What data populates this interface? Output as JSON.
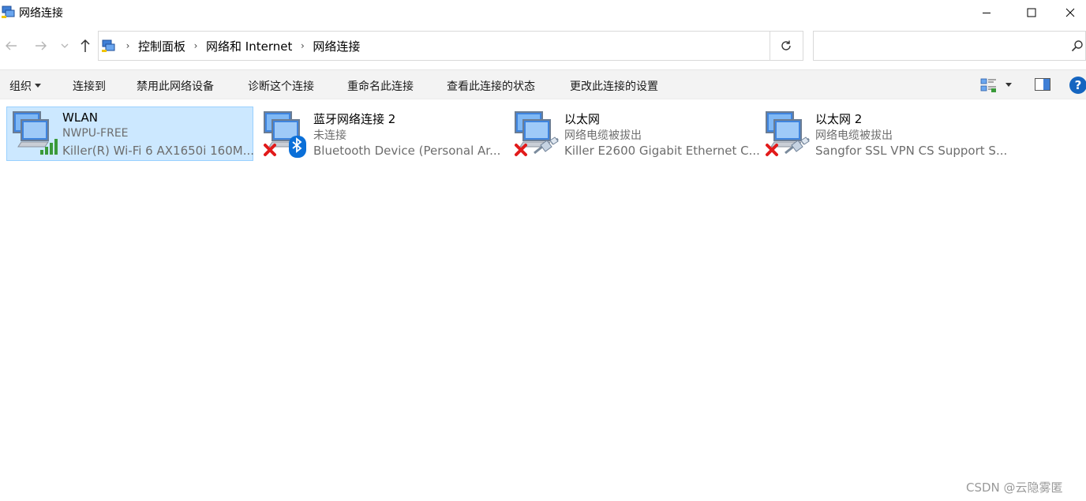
{
  "window": {
    "title": "网络连接"
  },
  "address": {
    "crumbs": [
      "控制面板",
      "网络和 Internet",
      "网络连接"
    ]
  },
  "search": {
    "placeholder": ""
  },
  "toolbar": {
    "organize": "组织",
    "connect": "连接到",
    "disable": "禁用此网络设备",
    "diagnose": "诊断这个连接",
    "rename": "重命名此连接",
    "status": "查看此连接的状态",
    "settings": "更改此连接的设置",
    "help": "?"
  },
  "items": [
    {
      "name": "WLAN",
      "status": "NWPU-FREE",
      "device": "Killer(R) Wi-Fi 6 AX1650i 160M...",
      "icon": "wifi-signal-icon",
      "selected": true
    },
    {
      "name": "蓝牙网络连接 2",
      "status": "未连接",
      "device": "Bluetooth Device (Personal Ar...",
      "icon": "bluetooth-icon",
      "selected": false
    },
    {
      "name": "以太网",
      "status": "网络电缆被拔出",
      "device": "Killer E2600 Gigabit Ethernet C...",
      "icon": "ethernet-cable-icon",
      "selected": false
    },
    {
      "name": "以太网 2",
      "status": "网络电缆被拔出",
      "device": "Sangfor SSL VPN CS Support S...",
      "icon": "ethernet-cable-icon",
      "selected": false
    }
  ],
  "watermark": "CSDN @云隐雾匿",
  "colors": {
    "selection_bg": "#cce8ff",
    "selection_border": "#99d1ff",
    "error_red": "#e21b1b",
    "bluetooth_blue": "#0a6fd8",
    "signal_green": "#3a9a3a",
    "help_blue": "#1565c0"
  }
}
